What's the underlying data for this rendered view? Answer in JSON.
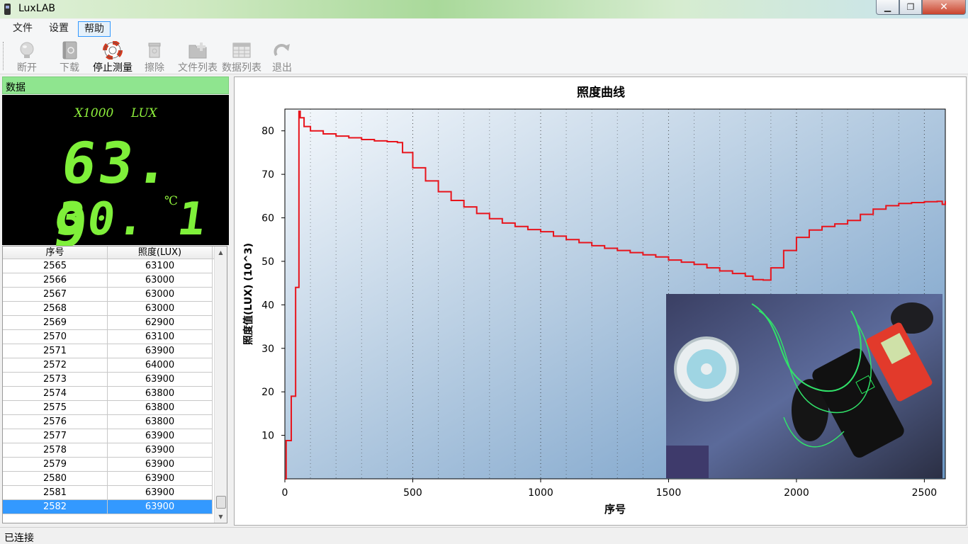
{
  "window": {
    "title": "LuxLAB"
  },
  "menu": {
    "file": "文件",
    "settings": "设置",
    "help": "帮助"
  },
  "toolbar": {
    "disconnect": "断开",
    "download": "下载",
    "stop_measure": "停止测量",
    "erase": "擦除",
    "file_list": "文件列表",
    "data_list": "数据列表",
    "exit": "退出"
  },
  "data_panel": {
    "header": "数据",
    "multiplier": "X1000",
    "unit": "LUX",
    "lux_value": "63. 9",
    "temp_value": "30. 1",
    "temp_unit": "℃"
  },
  "table": {
    "columns": [
      "序号",
      "照度(LUX)"
    ],
    "rows": [
      [
        "2565",
        "63100"
      ],
      [
        "2566",
        "63000"
      ],
      [
        "2567",
        "63000"
      ],
      [
        "2568",
        "63000"
      ],
      [
        "2569",
        "62900"
      ],
      [
        "2570",
        "63100"
      ],
      [
        "2571",
        "63900"
      ],
      [
        "2572",
        "64000"
      ],
      [
        "2573",
        "63900"
      ],
      [
        "2574",
        "63800"
      ],
      [
        "2575",
        "63800"
      ],
      [
        "2576",
        "63800"
      ],
      [
        "2577",
        "63900"
      ],
      [
        "2578",
        "63900"
      ],
      [
        "2579",
        "63900"
      ],
      [
        "2580",
        "63900"
      ],
      [
        "2581",
        "63900"
      ],
      [
        "2582",
        "63900"
      ]
    ],
    "selected_row": "2582"
  },
  "colors": {
    "line": "#e8141c",
    "lcd": "#7ff03a",
    "header_green": "#8fe58f",
    "selected": "#3399ff"
  },
  "chart_data": {
    "type": "line",
    "title": "照度曲线",
    "xlabel": "序号",
    "ylabel": "照度值(LUX)  (10^3)",
    "xlim": [
      0,
      2582
    ],
    "ylim": [
      0,
      85
    ],
    "xticks": [
      0,
      500,
      1000,
      1500,
      2000,
      2500
    ],
    "yticks": [
      10,
      20,
      30,
      40,
      50,
      60,
      70,
      80
    ],
    "grid": "vertical dotted",
    "series": [
      {
        "x": [
          0,
          5,
          8,
          25,
          28,
          42,
          46,
          55,
          60,
          75,
          100,
          150,
          200,
          250,
          300,
          350,
          400,
          440,
          460,
          500,
          550,
          600,
          650,
          700,
          750,
          800,
          850,
          900,
          950,
          1000,
          1050,
          1100,
          1150,
          1200,
          1250,
          1300,
          1350,
          1400,
          1450,
          1500,
          1550,
          1600,
          1650,
          1700,
          1750,
          1800,
          1830,
          1870,
          1900,
          1950,
          2000,
          2050,
          2100,
          2150,
          2200,
          2250,
          2300,
          2350,
          2400,
          2450,
          2500,
          2550,
          2570,
          2582
        ],
        "y": [
          0,
          8.8,
          8.8,
          19,
          19,
          44,
          44,
          84.5,
          83,
          81,
          80,
          79.3,
          78.8,
          78.4,
          78,
          77.7,
          77.5,
          77.3,
          75,
          71.5,
          68.5,
          66,
          64,
          62.5,
          61,
          59.8,
          58.8,
          58,
          57.3,
          56.8,
          55.8,
          55,
          54.3,
          53.6,
          53,
          52.5,
          52,
          51.5,
          51,
          50.3,
          49.8,
          49.3,
          48.5,
          47.8,
          47.2,
          46.6,
          45.8,
          45.7,
          48.5,
          52.5,
          55.5,
          57.2,
          58,
          58.6,
          59.4,
          60.8,
          62,
          62.8,
          63.3,
          63.5,
          63.7,
          63.8,
          63.1,
          63.9
        ]
      }
    ]
  },
  "status": {
    "text": "已连接"
  }
}
